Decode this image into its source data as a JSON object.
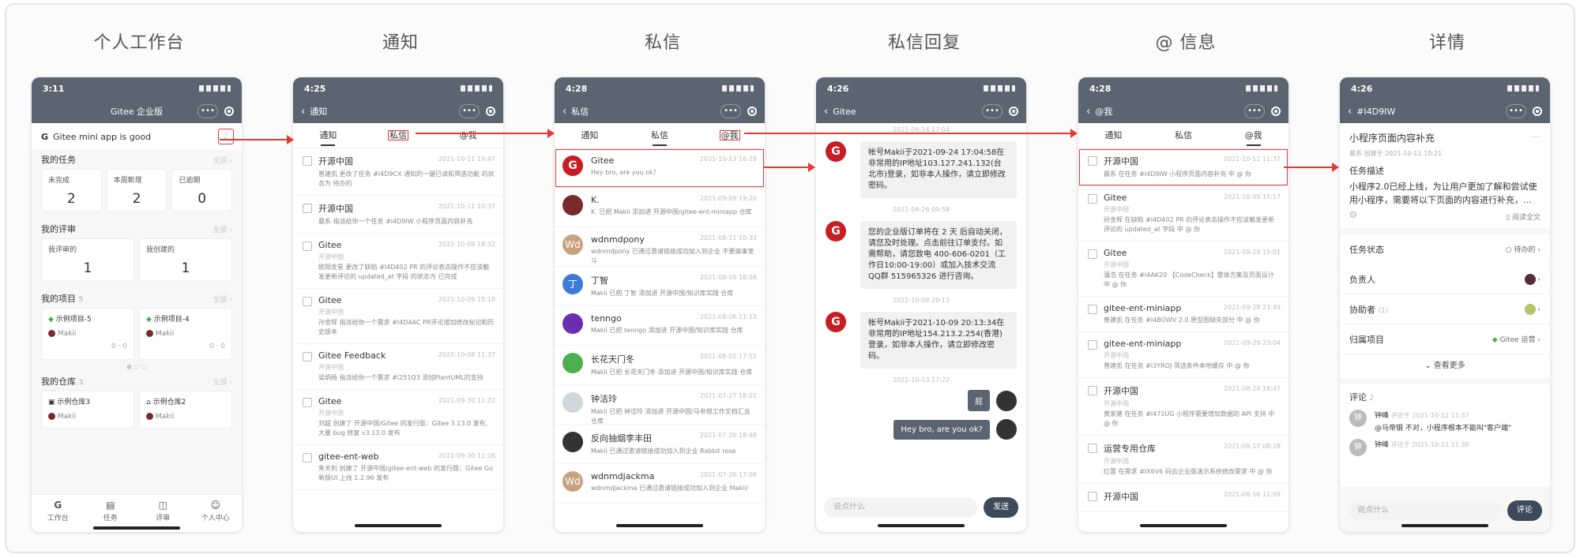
{
  "column_titles": [
    "个人工作台",
    "通知",
    "私信",
    "私信回复",
    "@ 信息",
    "详情"
  ],
  "p1": {
    "time": "3:11",
    "title": "Gitee 企业版",
    "greeting": "Gitee mini app is good",
    "tasks": {
      "label": "我的任务",
      "all": "全部",
      "cards": [
        {
          "label": "未完成",
          "n": "2"
        },
        {
          "label": "本周新增",
          "n": "2"
        },
        {
          "label": "已逾期",
          "n": "0"
        }
      ]
    },
    "reviews": {
      "label": "我的评审",
      "all": "全部",
      "cards": [
        {
          "label": "我评审的",
          "n": "1"
        },
        {
          "label": "我创建的",
          "n": "1"
        }
      ]
    },
    "projects": {
      "label": "我的项目",
      "count": "5",
      "all": "全部",
      "cards": [
        {
          "name": "示例项目-5",
          "owner": "Makii",
          "a": "0",
          "b": "0"
        },
        {
          "name": "示例项目-4",
          "owner": "Makii",
          "a": "0",
          "b": "0"
        }
      ]
    },
    "repos": {
      "label": "我的仓库",
      "count": "3",
      "all": "全部",
      "cards": [
        {
          "name": "示例仓库3",
          "owner": "Makii"
        },
        {
          "name": "示例仓库2",
          "owner": "Makii"
        }
      ]
    },
    "tabbar": [
      "工作台",
      "任务",
      "评审",
      "个人中心"
    ]
  },
  "p2": {
    "time": "4:25",
    "title": "通知",
    "tabs": [
      "通知",
      "私信",
      "@我"
    ],
    "items": [
      {
        "t": "开源中国",
        "tm": "2021-10-11 19:47",
        "sub": "",
        "p": "曾建凯 更改了任务 #I4D9CX 通知的一键已读和筛选功能 的状态为 待办的"
      },
      {
        "t": "开源中国",
        "tm": "2021-10-11 10:37",
        "sub": "",
        "p": "晨系 指派给你一个任务 #I4D9IW 小程序页面内容补充"
      },
      {
        "t": "Gitee",
        "tm": "2021-10-09 18:32",
        "sub": "开源中国",
        "p": "欧阳金星 更改了缺陷 #I4D402 PR 的评论表态操作不应该触发更新评论的 updated_at 字段 的状态为 已完成"
      },
      {
        "t": "Gitee",
        "tm": "2021-10-09 15:18",
        "sub": "开源中国",
        "p": "孙金辉 指派给你一个需求 #I4D4AC PR评论增加修改标记和历史版本"
      },
      {
        "t": "Gitee Feedback",
        "tm": "2021-10-08 11:37",
        "sub": "开源中国",
        "p": "梁炳杨 指派给你一个需求 #I251Q3 添加PlantUML的支持"
      },
      {
        "t": "Gitee",
        "tm": "2021-09-30 11:22",
        "sub": "开源中国",
        "p": "刘超 创建了 开源中国/Gitee 的发行版：Gitee 3.13.0 发布, 大量 bug 修复 v3.13.0 发布"
      },
      {
        "t": "gitee-ent-web",
        "tm": "2021-09-30 11:16",
        "sub": "",
        "p": "朱天利 创建了 开源中国/gitee-ent-web 的发行版：Gitee Go 新版UI 上线 1.2.96 发布"
      }
    ]
  },
  "p3": {
    "time": "4:28",
    "title": "私信",
    "tabs": [
      "通知",
      "私信",
      "@我"
    ],
    "items": [
      {
        "t": "Gitee",
        "tm": "2021-10-13 16:28",
        "p": "Hey bro, are you ok?",
        "av": "G",
        "c": "#c71d23"
      },
      {
        "t": "K.",
        "tm": "2021-09-09 19:20",
        "p": "K. 已把 Makii 添加进 开源中国/gitee-ent-miniapp 仓库",
        "av": "",
        "c": "#7a2a2a"
      },
      {
        "t": "wdnmdpony",
        "tm": "2021-08-11 10:33",
        "p": "wdnmdpony 已通过邀请链接成功加入到企业 不要搞事室斗",
        "av": "Wd",
        "c": "#c9a27e"
      },
      {
        "t": "丁智",
        "tm": "2021-08-09 18:08",
        "p": "Makii 已把 丁智 添加进 开源中国/知识库实践 仓库",
        "av": "丁",
        "c": "#3d7bd9"
      },
      {
        "t": "tenngo",
        "tm": "2021-08-06 11:13",
        "p": "Makii 已把 tenngo 添加进 开源中国/知识库实践 仓库",
        "av": "",
        "c": "#6a2fb0"
      },
      {
        "t": "长花天门冬",
        "tm": "2021-08-02 17:51",
        "p": "Makii 已把 长花天门冬 添加进 开源中国/知识库实践 仓库",
        "av": "",
        "c": "#4caf50"
      },
      {
        "t": "钟洁玲",
        "tm": "2021-07-27 18:01",
        "p": "Makii 已把 钟洁玲 添加进 开源中国/马帝银工作文档汇总 仓库",
        "av": "",
        "c": "#cfd8dc"
      },
      {
        "t": "反向抽烟李丰田",
        "tm": "2021-07-26 18:48",
        "p": "Makii 已通过邀请链接成功加入到企业 Rabbit rose",
        "av": "",
        "c": "#333"
      },
      {
        "t": "wdnmdjackma",
        "tm": "2021-07-26 17:08",
        "p": "wdnmdjackma 已通过邀请链接成功加入到企业 Makii/",
        "av": "Wd",
        "c": "#c9a27e"
      }
    ]
  },
  "p4": {
    "time": "4:26",
    "title": "Gitee",
    "msgs": [
      {
        "ts": "2021-09-24 17:04",
        "text": "帐号Makii于2021-09-24 17:04:58在非常用的IP地址103.127.241.132(台北市)登录，如非本人操作，请立即修改密码。"
      },
      {
        "ts": "2021-09-26 09:58",
        "text": "您的企业版订单将在 2 天 后自动关闭，请您及时处理。点击前往订单支付。如需帮助，请您致电 400-606-0201（工作日10:00-19:00）或加入技术交流 QQ群 515965326 进行咨询。"
      },
      {
        "ts": "2021-10-09 20:13",
        "text": "帐号Makii于2021-10-09 20:13:34在非常用的IP地址154.213.2.254(香港)登录，如非本人操作，请立即修改密码。"
      }
    ],
    "reply_ts": "2021-10-13 17:22",
    "reply1": "屁",
    "reply2": "Hey bro, are you ok?",
    "placeholder": "说点什么",
    "send": "发送"
  },
  "p5": {
    "time": "4:28",
    "title": "@我",
    "tabs": [
      "通知",
      "私信",
      "@我"
    ],
    "items": [
      {
        "t": "开源中国",
        "tm": "2021-10-12 11:37",
        "sub": "",
        "p": "晨系 在任务 #I4D9IW 小程序页面内容补充 中 @ 你"
      },
      {
        "t": "Gitee",
        "tm": "2021-10-09 15:17",
        "sub": "开源中国",
        "p": "孙金辉 在缺陷 #I4D402 PR 的评论表态操作不应该触发更新评论的 updated_at 字段 中 @ 你"
      },
      {
        "t": "Gitee",
        "tm": "2021-09-29 15:01",
        "sub": "开源中国",
        "p": "蒲浩 在任务 #I4AK20 【CodeCheck】整体方案及页面设计 中 @ 你"
      },
      {
        "t": "gitee-ent-miniapp",
        "tm": "2021-09-28 23:49",
        "sub": "",
        "p": "曾建凯 在任务 #I4BOWV 2.0 原型图缺失部分 中 @ 你"
      },
      {
        "t": "gitee-ent-miniapp",
        "tm": "2021-09-29 23:04",
        "sub": "开源中国",
        "p": "曾建凯 在任务 #I3YROJ 筛选条件本地缓存 中 @ 你"
      },
      {
        "t": "开源中国",
        "tm": "2021-08-24 18:47",
        "sub": "开源中国",
        "p": "黄家建 在任务 #I471UG 小程序需要增加数据的 API 支持 中 @ 你"
      },
      {
        "t": "运营专用仓库",
        "tm": "2021-08-17 08:28",
        "sub": "开源中国",
        "p": "红蕾 在需求 #IX6V6 码云企业版演示系统修改需求 中 @ 你"
      },
      {
        "t": "开源中国",
        "tm": "2021-08-16 11:09",
        "sub": "",
        "p": ""
      }
    ]
  },
  "p6": {
    "time": "4:26",
    "title": "#I4D9IW",
    "task_title": "小程序页面内容补充",
    "meta_user": "晨系",
    "meta_time": "创建于 2021-10-11 10:21",
    "desc_label": "任务描述",
    "desc": "小程序2.0已经上线，为让用户更加了解和尝试使用小程序，需要将以下页面的内容进行补充，...",
    "read_all": "阅读全文",
    "rows": [
      {
        "k": "任务状态",
        "v": "待办的"
      },
      {
        "k": "负责人",
        "v": ""
      },
      {
        "k": "协助者",
        "v": "(1)"
      },
      {
        "k": "归属项目",
        "v": "Gitee 运营"
      }
    ],
    "more": "查看更多",
    "comments_label": "评论",
    "comments_count": "2",
    "comments": [
      {
        "user": "钟峰",
        "time": "评论于 2021-10-12 11:37",
        "text": "@马帝银 不对，小程序根本不能叫\"客户端\""
      },
      {
        "user": "钟峰",
        "time": "评论于 2021-10-12 11:38",
        "text": ""
      }
    ],
    "placeholder": "说点什么",
    "btn": "评论"
  }
}
